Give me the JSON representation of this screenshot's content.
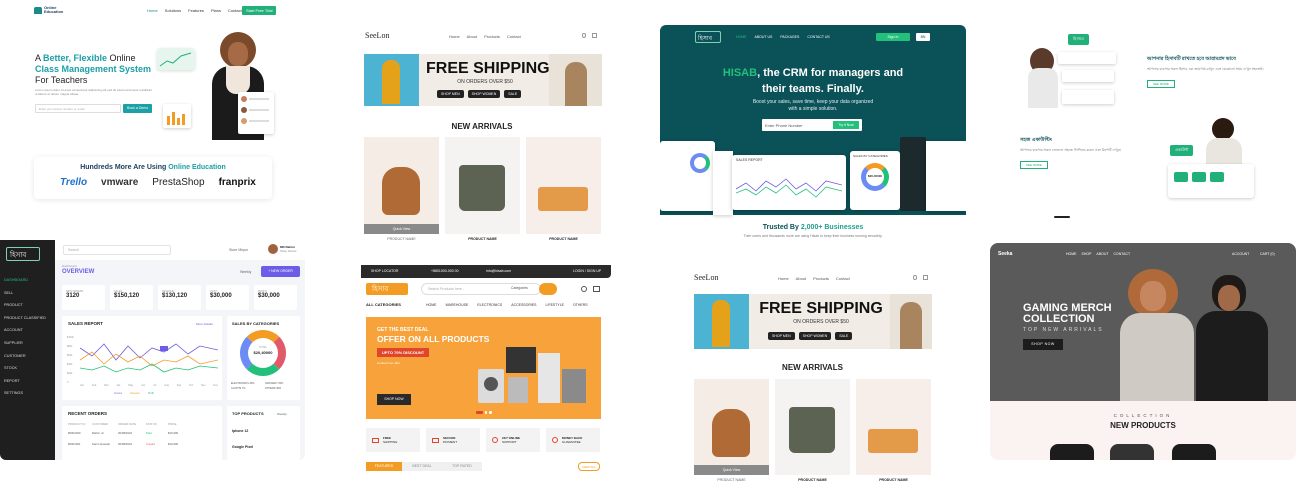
{
  "colors": {
    "teal": "#0b5158",
    "green": "#22c07a",
    "orange": "#f39c23",
    "purple": "#6c5ce7",
    "dark": "#1f1f1f",
    "sand": "#f4efe8"
  },
  "p1": {
    "brand_top": "Online",
    "brand_bottom": "Education",
    "nav": [
      "Home",
      "Solutions",
      "Features",
      "Plans",
      "Contact"
    ],
    "nav_cta": "Start Free Trial",
    "h_a": "A ",
    "h_b": "Better, Flexible ",
    "h_c": "Online",
    "h2": "Class Management System",
    "h3": "For Teachers",
    "sub": "Lorem ipsum dolor sit amet consectetur adipiscing elit sed do eiusmod tempor incididunt ut labore et dolore magna aliqua.",
    "phone_placeholder": "Enter your phone number or email",
    "demo": "Book a Demo",
    "more_a": "Hundreds More Are Using ",
    "more_b": "Online Education",
    "logos": [
      "Trello",
      "vmware",
      "PrestaShop",
      "franprix"
    ]
  },
  "p2": {
    "logo": "SeeLon",
    "nav": [
      "Home",
      "About",
      "Products",
      "Contact"
    ],
    "banner_title": "FREE SHIPPING",
    "banner_sub": "ON ORDERS OVER $50",
    "banner_btns": [
      "SHOP MEN",
      "SHOP WOMEN",
      "SALE"
    ],
    "arrivals": "NEW ARRIVALS",
    "quick_view": "Quick View",
    "products": [
      "PRODUCT NAME",
      "PRODUCT NAME",
      "PRODUCT NAME"
    ]
  },
  "p3": {
    "logo": "হিসাব",
    "nav": [
      "HOME",
      "ABOUT US",
      "PACKAGES",
      "CONTACT US"
    ],
    "signin": "Sign In",
    "lang": "BN",
    "h_a": "HISAB",
    "h_b": ", the CRM for managers and",
    "h_c": "their teams. Finally.",
    "sub1": "Boost your sales, save time, keep your data organized",
    "sub2": "with a simple solution.",
    "phone_placeholder": "Enter Phone Number",
    "try": "Try it Now",
    "trusted_a": "Trusted By ",
    "trusted_b": "2,000+ Businesses",
    "trusted_sub": "Their users and thousands more are using Hisab to keep their business running smoothly.",
    "dash_sales": "SALES REPORT",
    "dash_cat": "SALES BY CATEGORIES",
    "total_label": "TOTAL",
    "total": "$20,40000"
  },
  "p4": {
    "badge1": "হিসাবে",
    "t1": "আপনার হিসাবটি রাখতে হবে আরামপ্রদ ভাবে",
    "d1": "আপনার ব্যবসার সকল হিসাব এক জায়গায় রাখুন এবং যেকোনো সময় দেখুন সহজেই।",
    "b1": "SEE MORE",
    "t2": "সহজ একাউন্টিং",
    "d2": "আপনার ব্যবসার সকল লেনদেন সহজে লিপিবদ্ধ করুন এবং রিপোর্ট দেখুন।",
    "b2": "SEE MORE",
    "badge2": "একাউন্ট"
  },
  "p5": {
    "logo": "হিসাব",
    "search": "Search",
    "user": "MD Rahim",
    "role": "Shop Owner",
    "store": "Store Mirpur",
    "menu": [
      "DASHBOARD",
      "SELL",
      "PRODUCT",
      "PRODUCT CLASSIFIED",
      "ACCOUNT",
      "SUPPLIER",
      "CUSTOMER",
      "STOCK",
      "REPORT",
      "SETTINGS"
    ],
    "crumb": "Dashboard",
    "title": "OVERVIEW",
    "period": "Weekly",
    "new_order": "+ NEW ORDER",
    "stats": [
      {
        "l": "NEW ORDERS",
        "v": "3120"
      },
      {
        "l": "SALES",
        "v": "$150,120"
      },
      {
        "l": "REVENUE",
        "v": "$130,120"
      },
      {
        "l": "COST",
        "v": "$30,000"
      },
      {
        "l": "PROFIT",
        "v": "$30,000"
      }
    ],
    "sales_report": "SALES REPORT",
    "more": "More Details",
    "chart_y": [
      "$100k",
      "$80k",
      "$60k",
      "$40k",
      "$20k",
      "0"
    ],
    "chart_x": [
      "Jan",
      "Feb",
      "Mar",
      "Apr",
      "May",
      "Jun",
      "Jul",
      "Aug",
      "Sep",
      "Oct",
      "Nov",
      "Dec"
    ],
    "legend": [
      "Income",
      "Expense",
      "Profit"
    ],
    "cat_title": "SALES BY CATEGORIES",
    "total_label": "TOTAL",
    "total": "$20,40000",
    "cat_legend": [
      "ELECTRONICS 30%",
      "GROCERY 25%",
      "CLOTHS 7%",
      "OTHERS 38%"
    ],
    "recent": "RECENT ORDERS",
    "cols": [
      "PRODUCT ID",
      "CUSTOMER",
      "ORDER DATE",
      "STATUS",
      "PRICE"
    ],
    "rows": [
      [
        "#0001000",
        "Rahim uz",
        "20/08/2022",
        "Paid",
        "$10,000"
      ],
      [
        "#0001001",
        "Karim Hossain",
        "20/08/2022",
        "Unpaid",
        "$10,000"
      ]
    ],
    "top": "TOP PRODUCTS",
    "top_period": "Weekly",
    "top_items": [
      "Iphone 12",
      "Google Pixel"
    ]
  },
  "p6": {
    "topbar": [
      "SHOP LOCATOR",
      "+8801000-000 00",
      "info@hisab.com"
    ],
    "login": "LOGIN / SIGN UP",
    "logo": "হিসাব",
    "search_placeholder": "Search Products here...",
    "categories": "Categories",
    "all_cat": "ALL CATEGORIES",
    "nav": [
      "HOME",
      "WAREHOUSE",
      "ELECTRONICS",
      "ACCESSORIES",
      "LIFESTYLE",
      "OTHERS"
    ],
    "deal_small": "GET THE BEST DEAL",
    "deal_big": "OFFER ON ALL PRODUCTS",
    "deal_tag": "UPTO 70% DISCOUNT",
    "deal_sub": "Limited time offer",
    "shop_now": "SHOP NOW",
    "features": [
      {
        "a": "FREE",
        "b": "SHIPPING"
      },
      {
        "a": "SECURE",
        "b": "PAYMENT"
      },
      {
        "a": "24/7 ONLINE",
        "b": "SUPPORT"
      },
      {
        "a": "MONEY BACK",
        "b": "GUARANTEE"
      }
    ],
    "tabs": [
      "FEATURED",
      "BEST DEAL",
      "TOP RATED"
    ],
    "view_all": "VIEW ALL"
  },
  "p7": {
    "logo": "SeeLon",
    "nav": [
      "Home",
      "About",
      "Products",
      "Contact"
    ],
    "banner_title": "FREE SHIPPING",
    "banner_sub": "ON ORDERS OVER $50",
    "banner_btns": [
      "SHOP MEN",
      "SHOP WOMEN",
      "SALE"
    ],
    "arrivals": "NEW ARRIVALS",
    "quick_view": "Quick View",
    "products": [
      "PRODUCT NAME",
      "PRODUCT NAME",
      "PRODUCT NAME"
    ]
  },
  "p8": {
    "logo": "Seeka",
    "nav": [
      "HOME",
      "SHOP",
      "ABOUT",
      "CONTACT"
    ],
    "account": "ACCOUNT",
    "cart": "CART (0)",
    "h1": "GAMING MERCH",
    "h2": "COLLECTION",
    "h3": "TOP NEW ARRIVALS",
    "shop_now": "SHOP NOW",
    "collection": "COLLECTION",
    "new_products": "NEW PRODUCTS"
  }
}
